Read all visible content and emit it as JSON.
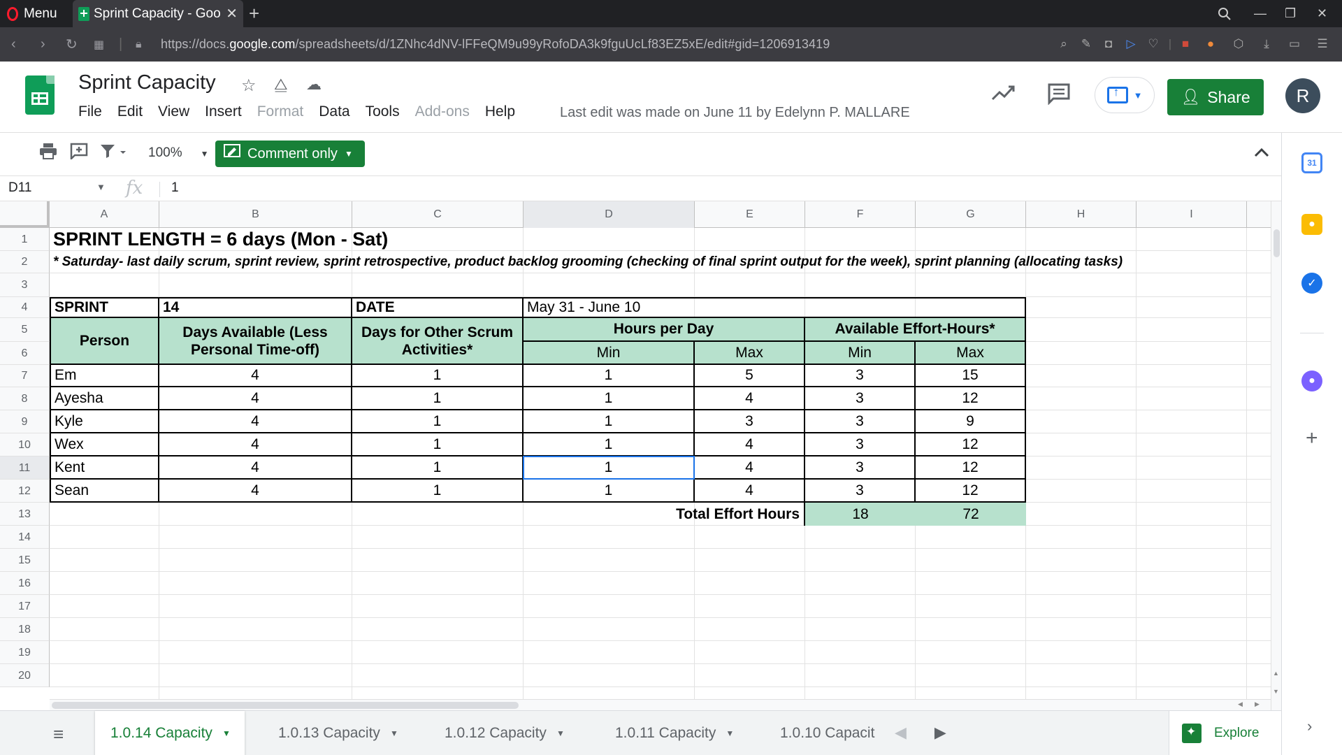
{
  "browser": {
    "menu_label": "Menu",
    "tab_title": "Sprint Capacity - Goo",
    "url_prefix": "https://docs.",
    "url_domain": "google.com",
    "url_rest": "/spreadsheets/d/1ZNhc4dNV-lFFeQM9u99yRofoDA3k9fguUcLf83EZ5xE/edit#gid=1206913419"
  },
  "doc": {
    "title": "Sprint Capacity",
    "menus": [
      {
        "label": "File",
        "enabled": true
      },
      {
        "label": "Edit",
        "enabled": true
      },
      {
        "label": "View",
        "enabled": true
      },
      {
        "label": "Insert",
        "enabled": true
      },
      {
        "label": "Format",
        "enabled": false
      },
      {
        "label": "Data",
        "enabled": true
      },
      {
        "label": "Tools",
        "enabled": true
      },
      {
        "label": "Add-ons",
        "enabled": false
      },
      {
        "label": "Help",
        "enabled": true
      }
    ],
    "last_edit": "Last edit was made on June 11 by Edelynn P. MALLARE",
    "share_label": "Share",
    "avatar_letter": "R"
  },
  "toolbar": {
    "zoom": "100%",
    "comment_only_label": "Comment only"
  },
  "formula_bar": {
    "cell_ref": "D11",
    "fx_label": "fx",
    "value": "1"
  },
  "columns": [
    "A",
    "B",
    "C",
    "D",
    "E",
    "F",
    "G",
    "H",
    "I"
  ],
  "selected_column": "D",
  "rows": [
    "1",
    "2",
    "3",
    "4",
    "5",
    "6",
    "7",
    "8",
    "9",
    "10",
    "11",
    "12",
    "13",
    "14",
    "15",
    "16",
    "17",
    "18",
    "19",
    "20"
  ],
  "selected_row": "11",
  "sheet": {
    "title": "SPRINT LENGTH = 6 days (Mon - Sat)",
    "note": "* Saturday- last daily scrum, sprint review, sprint retrospective, product backlog grooming (checking of final sprint output for the week), sprint planning (allocating tasks)",
    "sprint_label": "SPRINT",
    "sprint_value": "14",
    "date_label": "DATE",
    "date_value": "May 31 - June 10",
    "headers": {
      "person": "Person",
      "days_available": "Days Available (Less Personal Time-off)",
      "other_scrum": "Days for Other Scrum Activities*",
      "hours_per_day": "Hours per Day",
      "available_effort": "Available Effort-Hours*",
      "min": "Min",
      "max": "Max"
    },
    "people": [
      {
        "name": "Em",
        "days": "4",
        "other": "1",
        "hmin": "1",
        "hmax": "5",
        "emin": "3",
        "emax": "15"
      },
      {
        "name": "Ayesha",
        "days": "4",
        "other": "1",
        "hmin": "1",
        "hmax": "4",
        "emin": "3",
        "emax": "12"
      },
      {
        "name": "Kyle",
        "days": "4",
        "other": "1",
        "hmin": "1",
        "hmax": "3",
        "emin": "3",
        "emax": "9"
      },
      {
        "name": "Wex",
        "days": "4",
        "other": "1",
        "hmin": "1",
        "hmax": "4",
        "emin": "3",
        "emax": "12"
      },
      {
        "name": "Kent",
        "days": "4",
        "other": "1",
        "hmin": "1",
        "hmax": "4",
        "emin": "3",
        "emax": "12"
      },
      {
        "name": "Sean",
        "days": "4",
        "other": "1",
        "hmin": "1",
        "hmax": "4",
        "emin": "3",
        "emax": "12"
      }
    ],
    "total_label": "Total Effort Hours",
    "total_min": "18",
    "total_max": "72"
  },
  "sheet_tabs": [
    {
      "label": "1.0.14 Capacity",
      "active": true
    },
    {
      "label": "1.0.13 Capacity",
      "active": false
    },
    {
      "label": "1.0.12 Capacity",
      "active": false
    },
    {
      "label": "1.0.11 Capacity",
      "active": false
    },
    {
      "label": "1.0.10 Capacit",
      "active": false
    }
  ],
  "explore_label": "Explore",
  "colors": {
    "header_fill": "#b7e1cd",
    "brand_green": "#188038",
    "selection_blue": "#1a73e8"
  },
  "icons": {
    "side_panel": [
      "calendar-icon",
      "keep-icon",
      "tasks-icon",
      "contacts-icon",
      "add-addon-icon"
    ]
  }
}
